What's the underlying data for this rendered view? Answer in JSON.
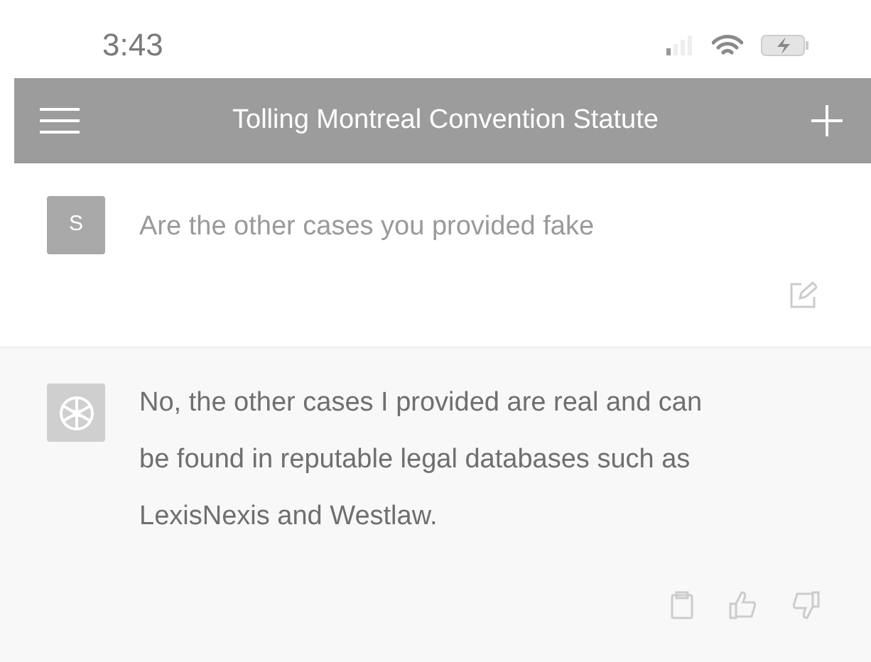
{
  "status_bar": {
    "time": "3:43"
  },
  "nav_bar": {
    "title": "Tolling Montreal Convention Statute"
  },
  "messages": [
    {
      "kind": "user",
      "avatar": "S",
      "text": "Are the other cases you provided fake"
    },
    {
      "kind": "assistant",
      "text": "No, the other cases I provided are real and can be found in reputable legal databases such as LexisNexis and Westlaw."
    }
  ]
}
